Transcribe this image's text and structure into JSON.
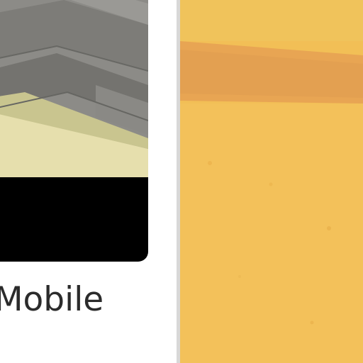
{
  "card": {
    "caption": "Mobile",
    "icon": "game-thumbnail",
    "colors": {
      "thumbnail_wall": "#8d8c88",
      "thumbnail_floor": "#e6dfaa",
      "thumbnail_shadow": "#6f6f6a",
      "bottom_bar": "#000000"
    }
  },
  "right_panel": {
    "icon": "sand-texture-image",
    "colors": {
      "base": "#f2bf56",
      "stripe": "#e4a050"
    }
  },
  "divider_color": "#d8d8d8"
}
